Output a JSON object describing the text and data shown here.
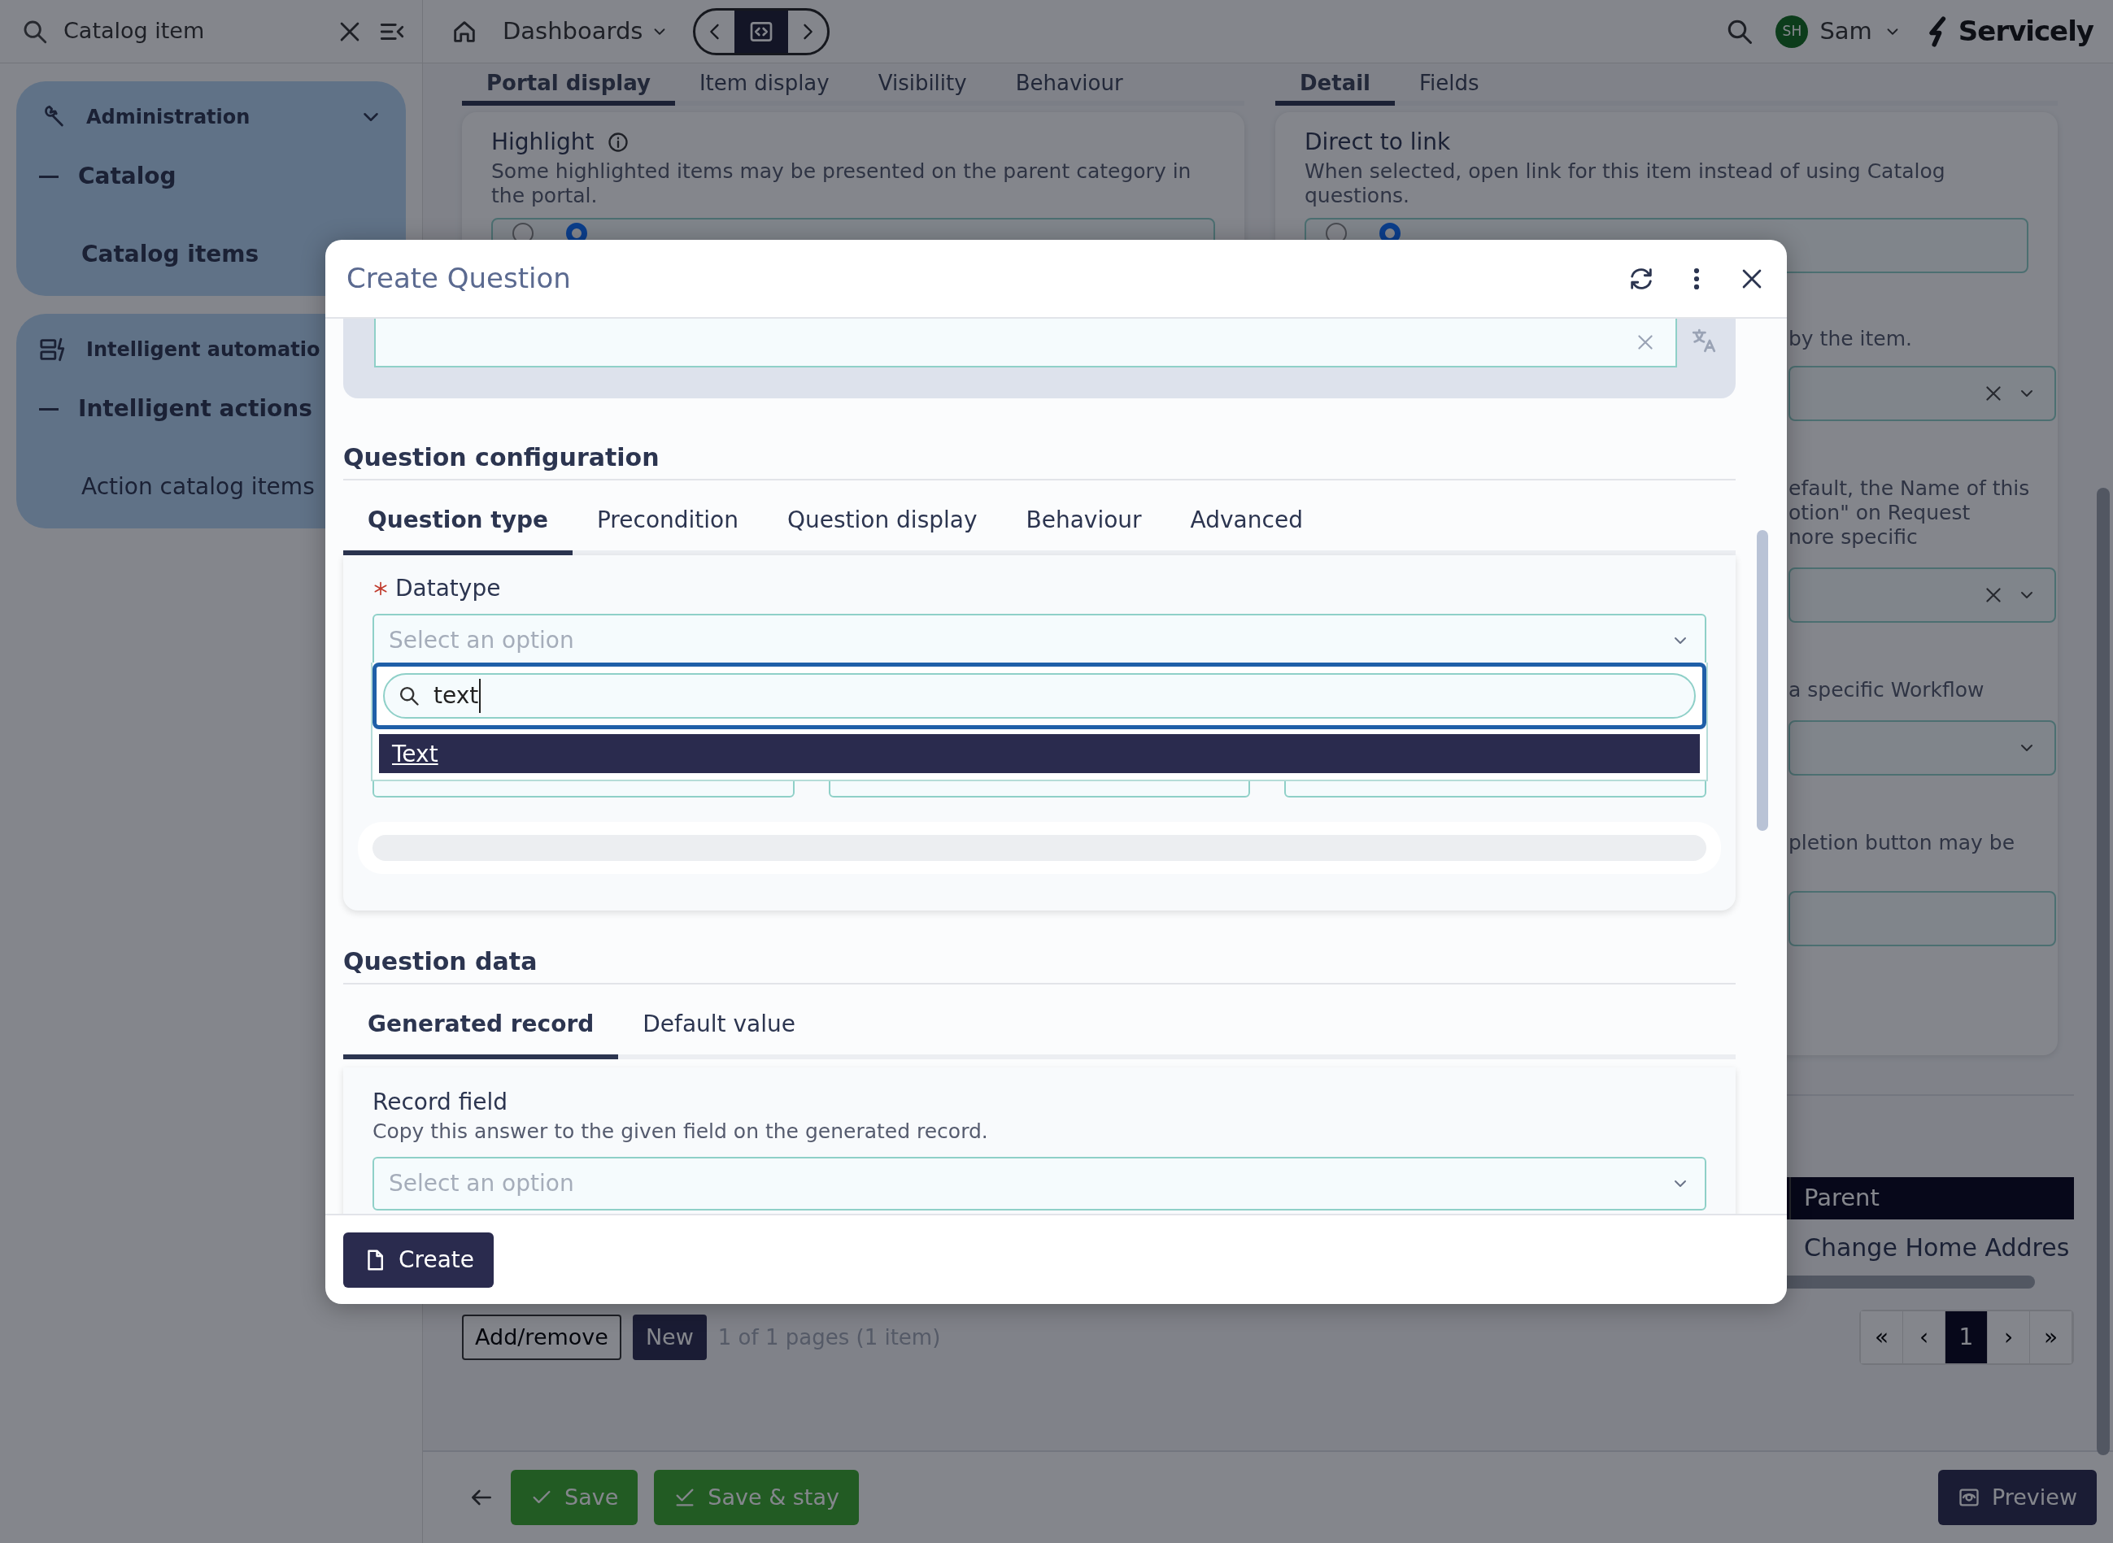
{
  "topbar": {
    "search": {
      "value": "Catalog item"
    },
    "menu": "Dashboards",
    "user": {
      "initials": "SH",
      "name": "Sam"
    },
    "brand": "Servicely"
  },
  "sidebar": {
    "groups": [
      {
        "title": "Administration",
        "items": [
          {
            "label": "Catalog",
            "children": [
              {
                "label": "Catalog items",
                "selected": true
              }
            ]
          }
        ]
      },
      {
        "title": "Intelligent automatio",
        "items": [
          {
            "label": "Intelligent actions",
            "children": [
              {
                "label": "Action catalog items",
                "selected": false
              }
            ]
          }
        ]
      }
    ]
  },
  "record": {
    "left": {
      "tabs": [
        {
          "label": "Portal display",
          "selected": true
        },
        {
          "label": "Item display",
          "selected": false
        },
        {
          "label": "Visibility",
          "selected": false
        },
        {
          "label": "Behaviour",
          "selected": false
        }
      ],
      "field": {
        "label": "Highlight",
        "help": "Some highlighted items may be presented on the parent category in the portal.",
        "options": [
          {
            "selected": false
          },
          {
            "selected": true
          }
        ]
      }
    },
    "right": {
      "tabs": [
        {
          "label": "Detail",
          "selected": true
        },
        {
          "label": "Fields",
          "selected": false
        }
      ],
      "field": {
        "label": "Direct to link",
        "help": "When selected, open link for this item instead of using Catalog questions.",
        "options": [
          {
            "selected": false
          },
          {
            "selected": true
          }
        ]
      },
      "fragments": [
        {
          "kind": "text",
          "lines": [
            "by the item."
          ]
        },
        {
          "kind": "select",
          "clearable": true
        },
        {
          "kind": "text",
          "lines": [
            "efault, the Name of this",
            "otion\" on Request",
            "nore specific"
          ]
        },
        {
          "kind": "select",
          "clearable": true
        },
        {
          "kind": "text",
          "lines": [
            "a specific Workflow"
          ]
        },
        {
          "kind": "select",
          "clearable": false
        },
        {
          "kind": "text",
          "lines": [
            "pletion button may be"
          ]
        },
        {
          "kind": "input"
        }
      ]
    }
  },
  "table": {
    "columns": [
      "Parent"
    ],
    "rows": [
      [
        "Change Home Addres"
      ]
    ]
  },
  "list_actions": {
    "buttons": [
      "Add/remove",
      "New"
    ],
    "summary": "1 of 1 pages (1 item)",
    "pages": [
      {
        "label": "«",
        "selected": false
      },
      {
        "label": "‹",
        "selected": false
      },
      {
        "label": "1",
        "selected": true
      },
      {
        "label": "›",
        "selected": false
      },
      {
        "label": "»",
        "selected": false
      }
    ]
  },
  "footer": {
    "buttons": [
      {
        "label": "Save",
        "kind": "save"
      },
      {
        "label": "Save & stay",
        "kind": "stay"
      },
      {
        "label": "Preview",
        "kind": "preview"
      }
    ]
  },
  "modal": {
    "title": "Create Question",
    "config": {
      "title": "Question configuration",
      "tabs": [
        {
          "label": "Question type",
          "selected": true
        },
        {
          "label": "Precondition",
          "selected": false
        },
        {
          "label": "Question display",
          "selected": false
        },
        {
          "label": "Behaviour",
          "selected": false
        },
        {
          "label": "Advanced",
          "selected": false
        }
      ],
      "datatype": {
        "label": "Datatype",
        "required": true,
        "placeholder": "Select an option",
        "search": {
          "value": "text"
        },
        "options": [
          {
            "label": "Text",
            "selected": true
          }
        ]
      }
    },
    "data": {
      "title": "Question data",
      "tabs": [
        {
          "label": "Generated record",
          "selected": true
        },
        {
          "label": "Default value",
          "selected": false
        }
      ],
      "field": {
        "label": "Record field",
        "help": "Copy this answer to the given field on the generated record.",
        "placeholder": "Select an option"
      }
    },
    "create": "Create"
  }
}
